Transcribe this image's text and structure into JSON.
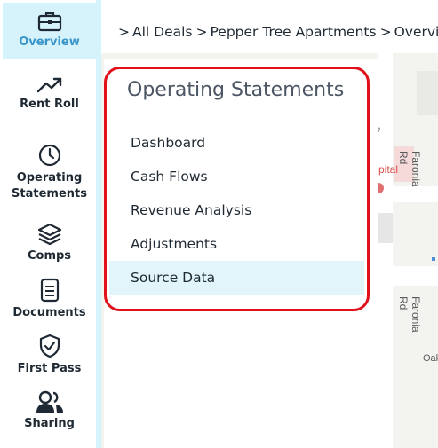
{
  "sidebar": {
    "items": [
      {
        "label": "Overview",
        "icon": "briefcase-icon",
        "active": true
      },
      {
        "label": "Rent Roll",
        "icon": "trending-up-icon",
        "active": false
      },
      {
        "label": "Operating Statements",
        "icon": "clock-icon",
        "active": false
      },
      {
        "label": "Comps",
        "icon": "layers-icon",
        "active": false
      },
      {
        "label": "Documents",
        "icon": "document-icon",
        "active": false
      },
      {
        "label": "First Pass",
        "icon": "shield-check-icon",
        "active": false
      },
      {
        "label": "Sharing",
        "icon": "users-icon",
        "active": false
      }
    ]
  },
  "breadcrumb": {
    "separator": ">",
    "items": [
      "All Deals",
      "Pepper Tree Apartments",
      "Overview"
    ]
  },
  "panel": {
    "title": "Operating Statements",
    "items": [
      {
        "label": "Dashboard",
        "selected": false
      },
      {
        "label": "Cash Flows",
        "selected": false
      },
      {
        "label": "Revenue Analysis",
        "selected": false
      },
      {
        "label": "Adjustments",
        "selected": false
      },
      {
        "label": "Source Data",
        "selected": true
      }
    ]
  },
  "map": {
    "labels": [
      "s Dr",
      "pital",
      "Faronia Rd",
      "Faronia Rd",
      "Oak"
    ]
  },
  "colors": {
    "accent": "#3a95c8",
    "active_bg": "#d6f3fb",
    "highlight": "#e0111b",
    "selected_bg": "#e1f5fb"
  }
}
